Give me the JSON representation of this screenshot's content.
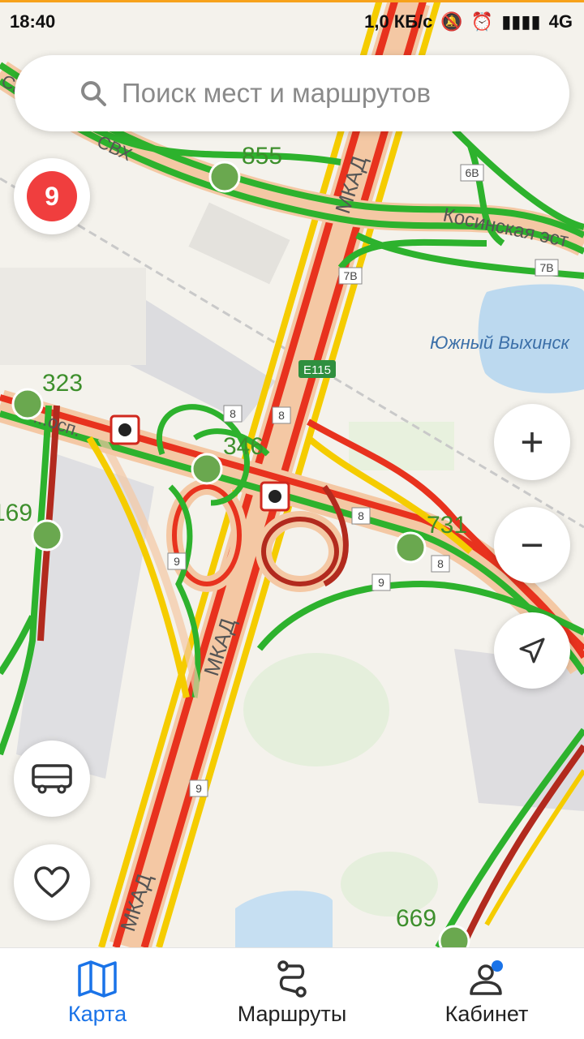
{
  "status_bar": {
    "time": "18:40",
    "network_speed": "1,0 КБ/с",
    "network_type": "4G"
  },
  "search": {
    "placeholder": "Поиск мест и маршрутов"
  },
  "traffic": {
    "score": "9",
    "badge_color": "#f03e3e"
  },
  "map": {
    "road_labels": {
      "mkad_top": "МКАД",
      "mkad_middle": "МКАД",
      "mkad_bottom": "МКАД",
      "svh_left": "СВХ",
      "svh": "СВХ",
      "kosinskaya": "Косинская эст",
      "ryazansky": "...осп.",
      "e115": "E115"
    },
    "area_labels": {
      "lake": "Южный Выхинск"
    },
    "exit_badges": [
      "6В",
      "7В",
      "7В",
      "8",
      "8",
      "8",
      "8",
      "9",
      "9",
      "9"
    ],
    "bus_stops": [
      {
        "number": "855"
      },
      {
        "number": "323"
      },
      {
        "number": "346"
      },
      {
        "number": "169"
      },
      {
        "number": "731"
      },
      {
        "number": "669"
      }
    ],
    "traffic_colors": {
      "free": "#2db22d",
      "slow": "#f5cc00",
      "jam": "#e8321e",
      "heavy": "#b22a1e"
    }
  },
  "controls": {
    "zoom_in": "+",
    "zoom_out": "−"
  },
  "tabs": [
    {
      "label": "Карта",
      "icon": "map-icon",
      "active": true
    },
    {
      "label": "Маршруты",
      "icon": "routes-icon",
      "active": false
    },
    {
      "label": "Кабинет",
      "icon": "profile-icon",
      "active": false
    }
  ],
  "accent_color": "#1a73e8"
}
